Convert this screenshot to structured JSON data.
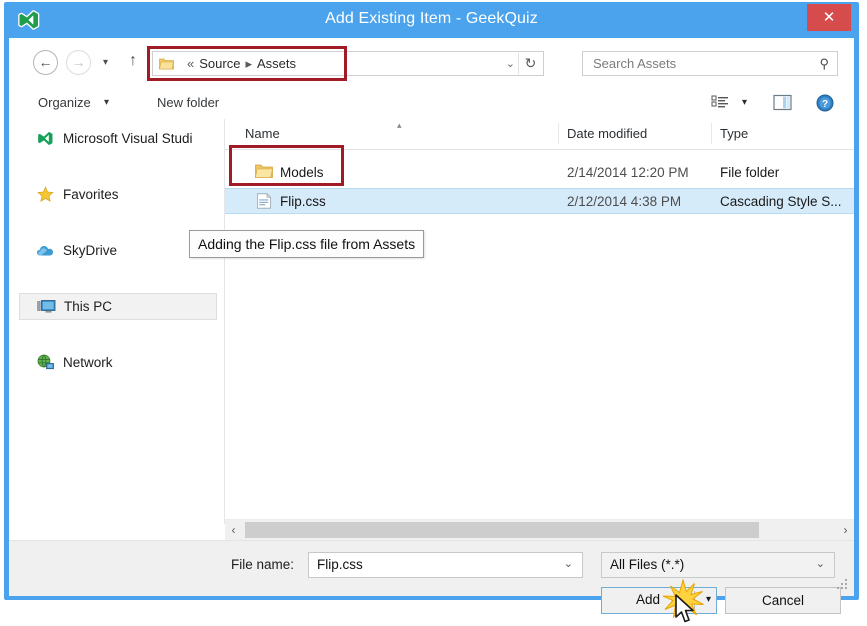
{
  "window": {
    "title": "Add Existing Item - GeekQuiz",
    "app_icon": "visual-studio-icon",
    "close_label": "✕",
    "titlebar_color": "#4aa3ec",
    "close_color": "#d64b4b"
  },
  "navbar": {
    "back_icon": "←",
    "forward_icon": "→",
    "recent_icon": "▾",
    "up_icon": "↑",
    "breadcrumb": {
      "prefix": "«",
      "items": [
        "Source",
        "Assets"
      ],
      "separator": "▸"
    },
    "address_dropdown_icon": "⌄",
    "refresh_icon": "↻",
    "search_placeholder": "Search Assets",
    "search_icon": "⚲",
    "highlight_color": "#a01b25"
  },
  "toolbar": {
    "organize_label": "Organize",
    "organize_caret": "▾",
    "new_folder_label": "New folder",
    "view_icon": "view-options-icon",
    "view_caret": "▾",
    "preview_pane_icon": "preview-pane-icon",
    "help_icon": "help-icon"
  },
  "sidebar": {
    "items": [
      {
        "label": "Microsoft Visual Studi",
        "icon": "visual-studio-icon",
        "selected": false
      },
      {
        "label": "Favorites",
        "icon": "star-icon",
        "selected": false
      },
      {
        "label": "SkyDrive",
        "icon": "cloud-icon",
        "selected": false
      },
      {
        "label": "This PC",
        "icon": "computer-icon",
        "selected": true
      },
      {
        "label": "Network",
        "icon": "network-globe-icon",
        "selected": false
      }
    ]
  },
  "filelist": {
    "columns": [
      "Name",
      "Date modified",
      "Type"
    ],
    "sort_indicator": "▴",
    "rows": [
      {
        "name": "Models",
        "date_modified": "2/14/2014 12:20 PM",
        "type": "File folder",
        "icon": "folder-icon",
        "selected": false
      },
      {
        "name": "Flip.css",
        "date_modified": "2/12/2014 4:38 PM",
        "type": "Cascading Style S...",
        "icon": "css-file-icon",
        "selected": true
      }
    ],
    "selection_color": "#d6ebfa"
  },
  "scrollbar": {
    "left_arrow": "‹",
    "right_arrow": "›"
  },
  "callout": {
    "text": "Adding the Flip.css file from Assets"
  },
  "bottom": {
    "filename_label": "File name:",
    "filename_value": "Flip.css",
    "filename_caret": "⌄",
    "filter_value": "All Files (*.*)",
    "filter_caret": "⌄",
    "add_label": "Add",
    "add_caret": "▾",
    "cancel_label": "Cancel"
  }
}
